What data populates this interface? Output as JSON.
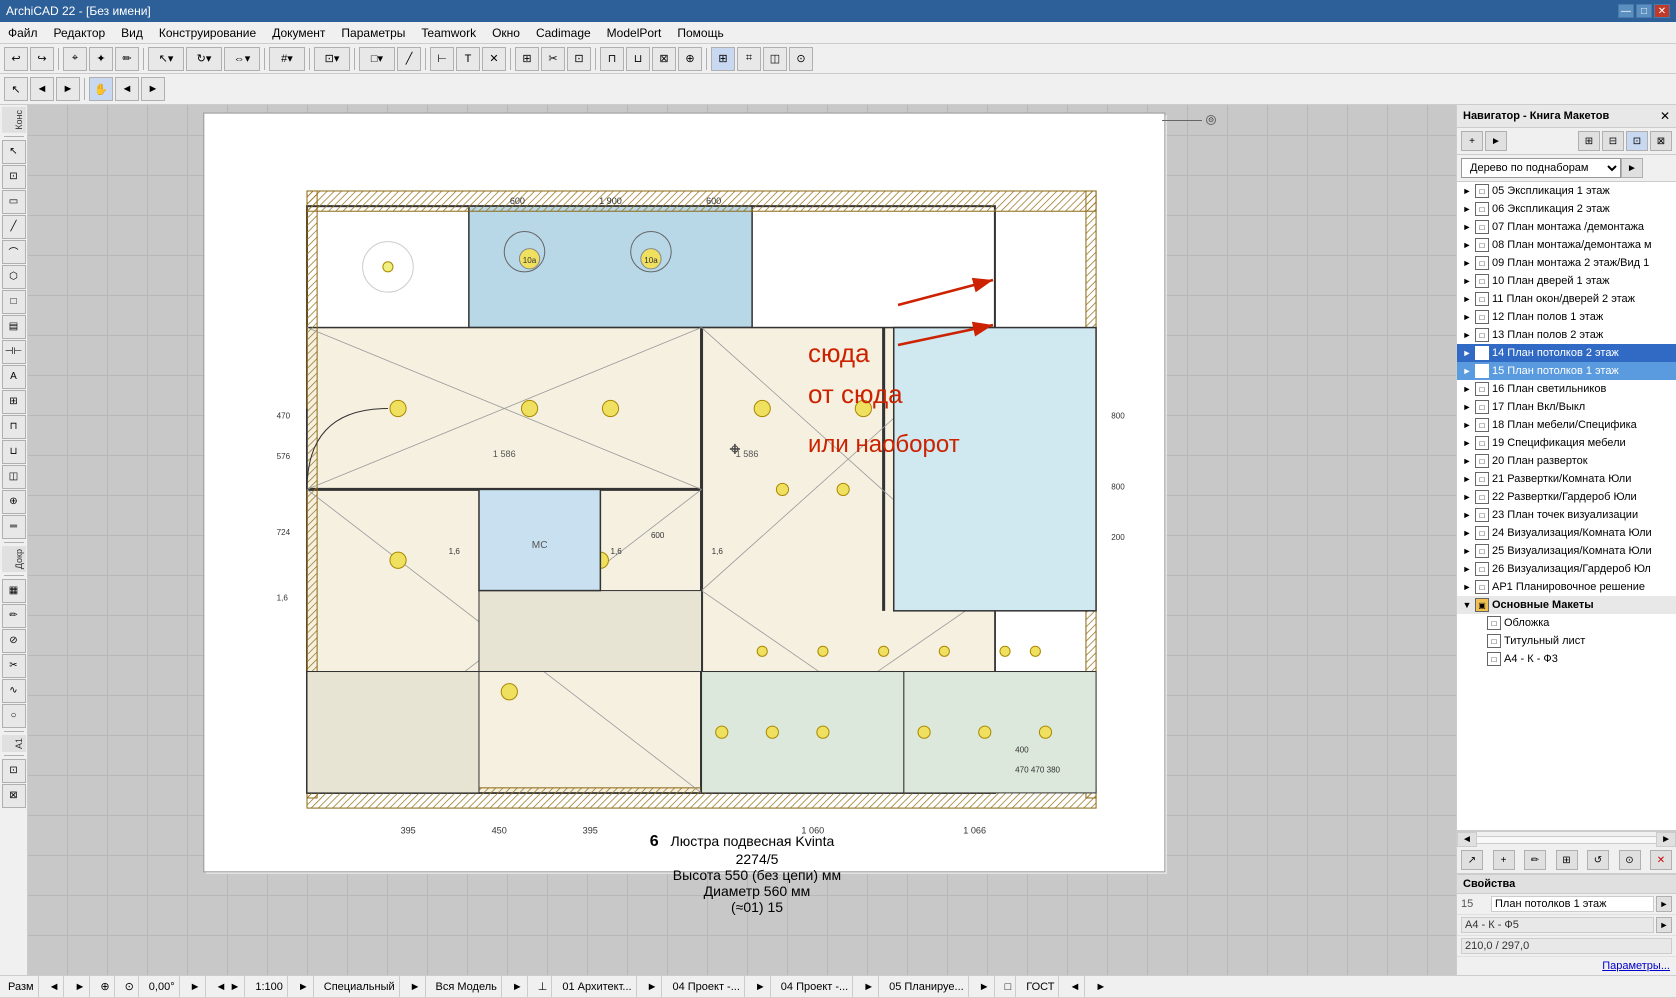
{
  "titleBar": {
    "title": "ArchiCAD 22 - [Без имени]",
    "controls": [
      "—",
      "□",
      "✕"
    ]
  },
  "menuBar": {
    "items": [
      "Файл",
      "Редактор",
      "Вид",
      "Конструирование",
      "Документ",
      "Параметры",
      "Teamwork",
      "Окно",
      "Cadimage",
      "ModelPort",
      "Помощь"
    ]
  },
  "leftPanel": {
    "labels": [
      "Конс",
      "Докр",
      "A1"
    ]
  },
  "navigator": {
    "title": "Навигатор - Книга Макетов",
    "treeSelector": "Дерево по поднаборам",
    "items": [
      {
        "id": "05",
        "label": "05 Экспликация 1 этаж",
        "indent": 1,
        "type": "page",
        "expanded": false
      },
      {
        "id": "06",
        "label": "06 Экспликация 2 этаж",
        "indent": 1,
        "type": "page",
        "expanded": false
      },
      {
        "id": "07",
        "label": "07 План монтажа /демонтажа",
        "indent": 1,
        "type": "page",
        "expanded": false
      },
      {
        "id": "08",
        "label": "08 План монтажа/демонтажа м",
        "indent": 1,
        "type": "page",
        "expanded": false
      },
      {
        "id": "09",
        "label": "09 План монтажа 2 этаж/Вид 1",
        "indent": 1,
        "type": "page",
        "expanded": false
      },
      {
        "id": "10",
        "label": "10 План дверей 1 этаж",
        "indent": 1,
        "type": "page",
        "expanded": false
      },
      {
        "id": "11",
        "label": "11 План окон/дверей 2 этаж",
        "indent": 1,
        "type": "page",
        "expanded": false
      },
      {
        "id": "12",
        "label": "12 План полов 1 этаж",
        "indent": 1,
        "type": "page",
        "expanded": false
      },
      {
        "id": "13",
        "label": "13 План полов 2 этаж",
        "indent": 1,
        "type": "page",
        "expanded": false
      },
      {
        "id": "14",
        "label": "14 План потолков 2 этаж",
        "indent": 1,
        "type": "page",
        "expanded": false,
        "selected": true
      },
      {
        "id": "15",
        "label": "15 План потолков 1 этаж",
        "indent": 1,
        "type": "page",
        "expanded": false,
        "selected2": true
      },
      {
        "id": "16",
        "label": "16 План светильников",
        "indent": 1,
        "type": "page",
        "expanded": false
      },
      {
        "id": "17",
        "label": "17 План Вкл/Выкл",
        "indent": 1,
        "type": "page",
        "expanded": false
      },
      {
        "id": "18",
        "label": "18 План мебели/Специфика",
        "indent": 1,
        "type": "page",
        "expanded": false
      },
      {
        "id": "19",
        "label": "19 Спецификация мебели",
        "indent": 1,
        "type": "page",
        "expanded": false
      },
      {
        "id": "20",
        "label": "20 План разверток",
        "indent": 1,
        "type": "page",
        "expanded": false
      },
      {
        "id": "21",
        "label": "21 Развертки/Комната Юли",
        "indent": 1,
        "type": "page",
        "expanded": false
      },
      {
        "id": "22",
        "label": "22 Развертки/Гардероб Юли",
        "indent": 1,
        "type": "page",
        "expanded": false
      },
      {
        "id": "23",
        "label": "23 План точек визуализации",
        "indent": 1,
        "type": "page",
        "expanded": false
      },
      {
        "id": "24",
        "label": "24 Визуализация/Комната Юли",
        "indent": 1,
        "type": "page",
        "expanded": false
      },
      {
        "id": "25",
        "label": "25 Визуализация/Комната Юли",
        "indent": 1,
        "type": "page",
        "expanded": false
      },
      {
        "id": "26",
        "label": "26 Визуализация/Гардероб Юл",
        "indent": 1,
        "type": "page",
        "expanded": false
      },
      {
        "id": "AP1",
        "label": "AP1 Планировочное решение",
        "indent": 1,
        "type": "page",
        "expanded": false
      },
      {
        "id": "main",
        "label": "Основные Макеты",
        "indent": 1,
        "type": "folder",
        "expanded": true
      },
      {
        "id": "cov",
        "label": "Обложка",
        "indent": 2,
        "type": "page"
      },
      {
        "id": "tit",
        "label": "Титульный лист",
        "indent": 2,
        "type": "page"
      },
      {
        "id": "a4k",
        "label": "А4 - К - Ф3",
        "indent": 2,
        "type": "page"
      }
    ]
  },
  "properties": {
    "header": "Свойства",
    "row1_key": "15",
    "row1_val": "План потолков 1 этаж",
    "row2_val": "А4 - К - Ф5",
    "row3_val": "210,0 / 297,0",
    "paramsBtn": "Параметры..."
  },
  "canvasInfo": {
    "number": "6",
    "line1": "Люстра подвесная Kvinta",
    "line2": "2274/5",
    "line3": "Высота 550 (без цепи) мм",
    "line4": "Диаметр 560 мм",
    "line5": "(≈01) 15"
  },
  "annotation": {
    "line1": "сюда",
    "line2": "от сюда",
    "line3": "или наоборот"
  },
  "statusBar": {
    "items": [
      "Разм",
      "◄",
      "►",
      "⊙",
      "⊙",
      "0,00°",
      "►",
      "◄ ►",
      "1:100",
      "►",
      "Специальный",
      "►",
      "Вся Модель",
      "►",
      "⊥",
      "01 Архитект...",
      "►",
      "04 Проект -...",
      "►",
      "04 Проект -...",
      "►",
      "05 Планируе...",
      "►",
      "□",
      "ГОСТ",
      "◄",
      "►"
    ]
  }
}
